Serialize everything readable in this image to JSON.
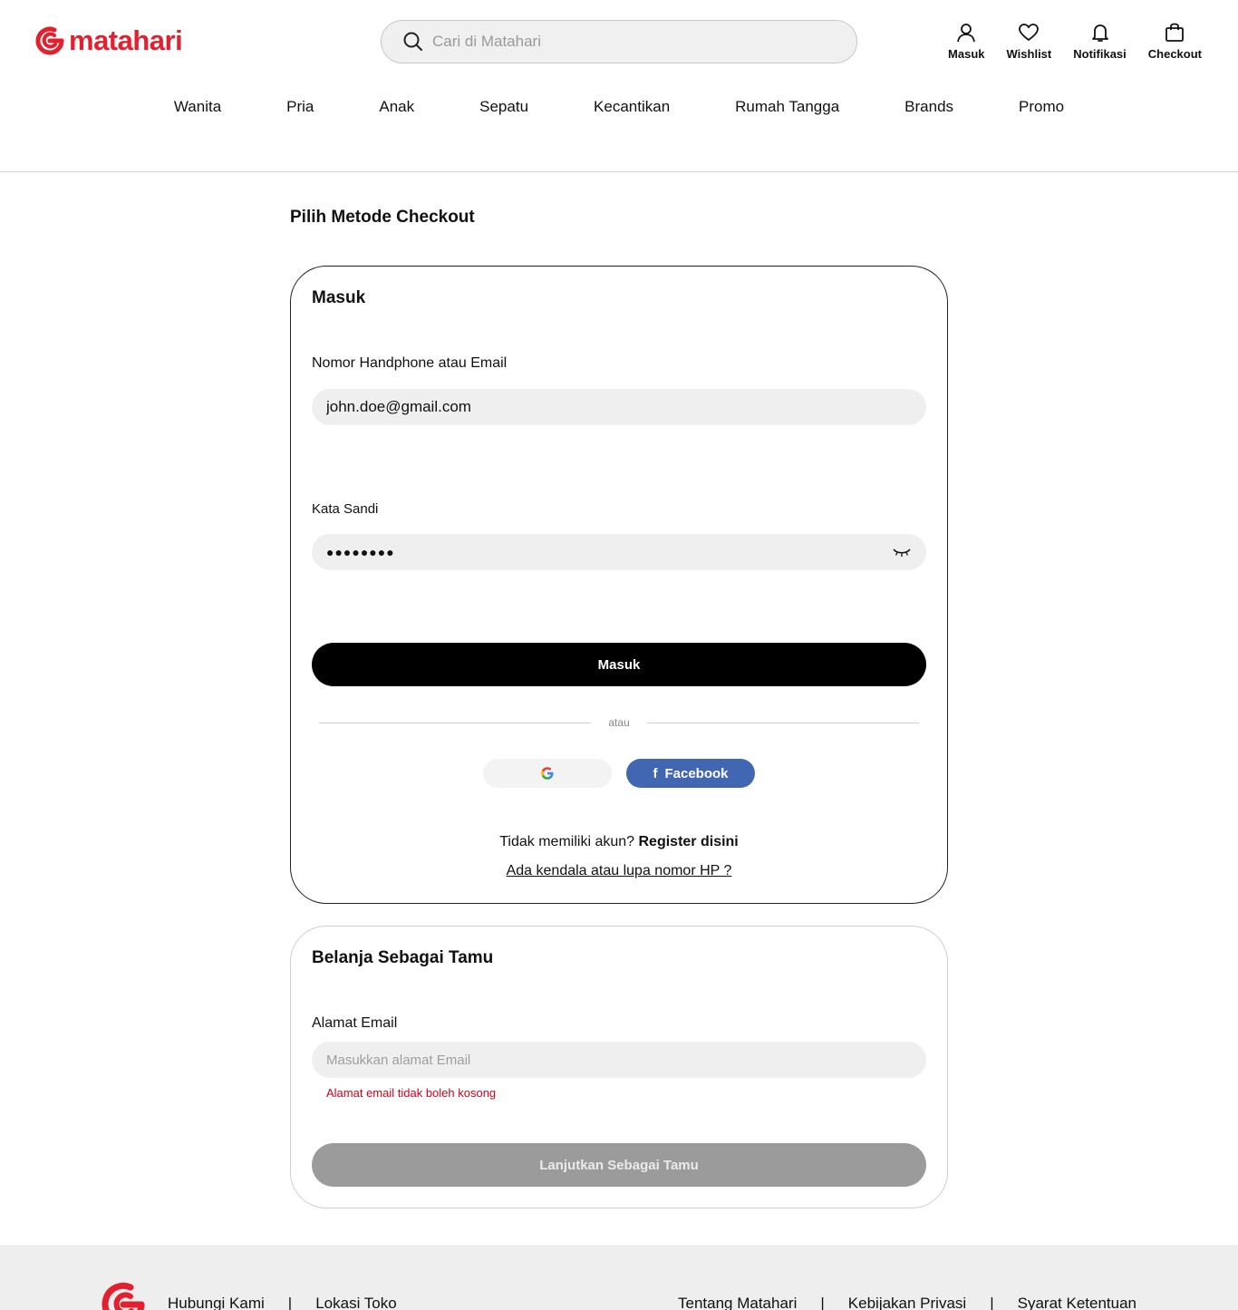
{
  "brand": {
    "name": "matahari",
    "color": "#e5202e"
  },
  "search": {
    "placeholder": "Cari di Matahari"
  },
  "header_actions": [
    {
      "label": "Masuk",
      "icon": "user-icon"
    },
    {
      "label": "Wishlist",
      "icon": "heart-icon"
    },
    {
      "label": "Notifikasi",
      "icon": "bell-icon"
    },
    {
      "label": "Checkout",
      "icon": "bag-icon"
    }
  ],
  "nav": [
    "Wanita",
    "Pria",
    "Anak",
    "Sepatu",
    "Kecantikan",
    "Rumah Tangga",
    "Brands",
    "Promo"
  ],
  "page_title": "Pilih Metode Checkout",
  "login": {
    "title": "Masuk",
    "id_label": "Nomor Handphone atau  Email",
    "id_value": "john.doe@gmail.com",
    "password_label": "Kata Sandi",
    "password_value": "●●●●●●●●",
    "submit_label": "Masuk",
    "divider": "atau",
    "facebook_label": "Facebook",
    "no_account_text": "Tidak memiliki akun?",
    "register_link": "Register disini",
    "help_link": "Ada kendala atau lupa nomor HP ?"
  },
  "guest": {
    "title": "Belanja Sebagai Tamu",
    "email_label": "Alamat Email",
    "email_placeholder": "Masukkan alamat Email",
    "error": "Alamat email tidak boleh kosong",
    "continue_label": "Lanjutkan Sebagai Tamu"
  },
  "footer": {
    "left_links": [
      "Hubungi Kami",
      "|",
      "Lokasi Toko"
    ],
    "right_links": [
      "Tentang Matahari",
      "|",
      "Kebijakan Privasi",
      "|",
      "Syarat Ketentuan"
    ]
  }
}
